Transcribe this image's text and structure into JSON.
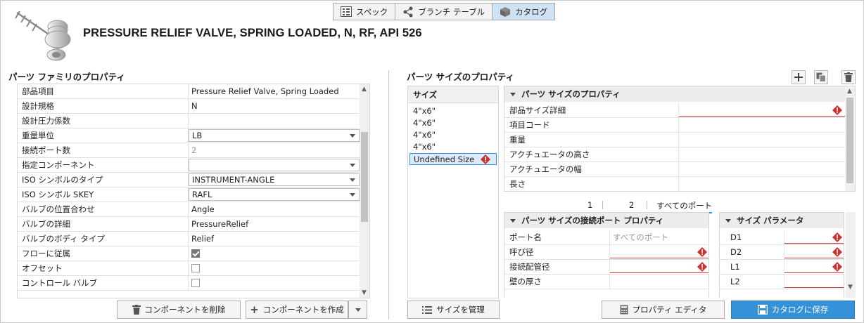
{
  "tabs": [
    {
      "label": "スペック",
      "icon": "list-icon",
      "active": false
    },
    {
      "label": "ブランチ テーブル",
      "icon": "share-icon",
      "active": false
    },
    {
      "label": "カタログ",
      "icon": "cube-icon",
      "active": true
    }
  ],
  "header": {
    "title": "PRESSURE RELIEF VALVE, SPRING LOADED, N, RF, API 526"
  },
  "family": {
    "heading": "パーツ ファミリのプロパティ",
    "rows": [
      {
        "key": "部品項目",
        "value": "Pressure Relief Valve, Spring Loaded"
      },
      {
        "key": "設計規格",
        "value": "N"
      },
      {
        "key": "設計圧力係数",
        "value": ""
      },
      {
        "key": "重量単位",
        "value": "LB"
      },
      {
        "key": "接続ポート数",
        "value": "2"
      },
      {
        "key": "指定コンポーネント",
        "value": ""
      },
      {
        "key": "ISO シンボルのタイプ",
        "value": "INSTRUMENT-ANGLE"
      },
      {
        "key": "ISO シンボル SKEY",
        "value": "RAFL"
      },
      {
        "key": "バルブの位置合わせ",
        "value": "Angle"
      },
      {
        "key": "バルブの詳細",
        "value": "PressureRelief"
      },
      {
        "key": "バルブのボディ タイプ",
        "value": "Relief"
      },
      {
        "key": "フローに従属",
        "value": "checked"
      },
      {
        "key": "オフセット",
        "value": "unchecked"
      },
      {
        "key": "コントロール バルブ",
        "value": "unchecked"
      }
    ],
    "delete_button": "コンポーネントを削除",
    "create_button": "コンポーネントを作成"
  },
  "sizes": {
    "heading": "パーツ サイズのプロパティ",
    "list_header": "サイズ",
    "items": [
      "4\"x6\"",
      "4\"x6\"",
      "4\"x6\"",
      "4\"x6\"",
      "Undefined Size"
    ],
    "manage_button": "サイズを管理"
  },
  "size_props": {
    "heading": "パーツ サイズのプロパティ",
    "rows": [
      "部品サイズ詳細",
      "項目コード",
      "重量",
      "アクチュエータの高さ",
      "アクチュエータの幅",
      "長さ"
    ]
  },
  "port_tabs": [
    "1",
    "2",
    "すべてのポート"
  ],
  "port_props": {
    "heading": "パーツ サイズの接続ポート プロパティ",
    "rows": [
      {
        "key": "ポート名",
        "value": "すべてのポート"
      },
      {
        "key": "呼び径",
        "value": ""
      },
      {
        "key": "接続配管径",
        "value": ""
      },
      {
        "key": "壁の厚さ",
        "value": ""
      }
    ]
  },
  "size_params": {
    "heading": "サイズ パラメータ",
    "rows": [
      "D1",
      "D2",
      "L1",
      "L2"
    ]
  },
  "footer": {
    "property_editor": "プロパティ エディタ",
    "save_catalog": "カタログに保存"
  },
  "colors": {
    "accent": "#3592d9",
    "error": "#d0302f",
    "selected": "#dbeafa"
  }
}
